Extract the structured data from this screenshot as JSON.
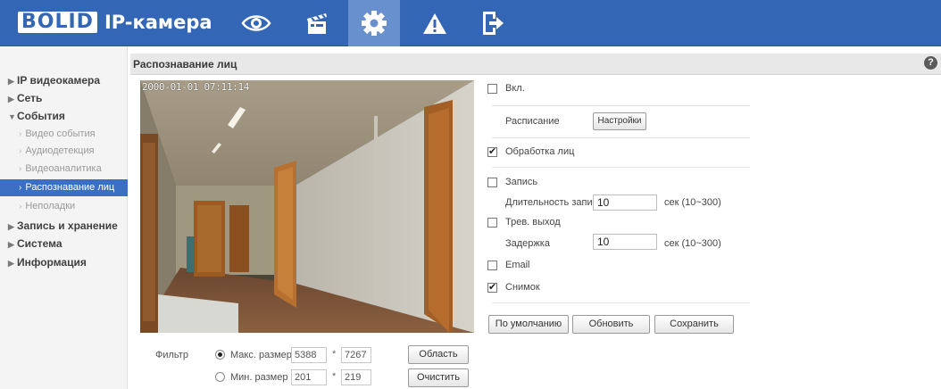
{
  "header": {
    "logo": "BOLID",
    "title": "IP-камера",
    "nav": [
      {
        "icon": "eye-icon"
      },
      {
        "icon": "clapperboard-icon"
      },
      {
        "icon": "gear-icon",
        "active": true
      },
      {
        "icon": "warning-icon"
      },
      {
        "icon": "logout-icon"
      }
    ]
  },
  "sidebar": {
    "items": [
      {
        "label": "IP видеокамера",
        "state": "collapsed"
      },
      {
        "label": "Сеть",
        "state": "collapsed"
      },
      {
        "label": "События",
        "state": "expanded"
      },
      {
        "label": "Запись и хранение",
        "state": "collapsed"
      },
      {
        "label": "Система",
        "state": "collapsed"
      },
      {
        "label": "Информация",
        "state": "collapsed"
      }
    ],
    "events_sub": [
      {
        "label": "Видео события"
      },
      {
        "label": "Аудиодетекция"
      },
      {
        "label": "Видеоаналитика"
      },
      {
        "label": "Распознавание лиц",
        "selected": true
      },
      {
        "label": "Неполадки"
      }
    ]
  },
  "page": {
    "title": "Распознавание лиц",
    "help": "?"
  },
  "video": {
    "timestamp": "2000-01-01 07:11:14"
  },
  "filter": {
    "label": "Фильтр",
    "max": {
      "label": "Макс. размер",
      "w": "5388",
      "h": "7267",
      "selected": true
    },
    "min": {
      "label": "Мин. размер",
      "w": "201",
      "h": "219",
      "selected": false
    },
    "separator": "*",
    "area_button": "Область",
    "clear_button": "Очистить"
  },
  "settings": {
    "enable": {
      "label": "Вкл.",
      "checked": false
    },
    "schedule_label": "Расписание",
    "schedule_button": "Настройки",
    "face_processing": {
      "label": "Обработка лиц",
      "checked": true
    },
    "record": {
      "label": "Запись",
      "checked": false
    },
    "record_duration_label": "Длительность записи",
    "record_duration_value": "10",
    "record_duration_unit": "сек (10~300)",
    "alarm_out": {
      "label": "Трев. выход",
      "checked": false
    },
    "delay_label": "Задержка",
    "delay_value": "10",
    "delay_unit": "сек (10~300)",
    "email": {
      "label": "Email",
      "checked": false
    },
    "snapshot": {
      "label": "Снимок",
      "checked": true
    }
  },
  "actions": {
    "default": "По умолчанию",
    "refresh": "Обновить",
    "save": "Сохранить"
  },
  "colors": {
    "header": "#3366b4",
    "selected": "#3a6fc4"
  }
}
